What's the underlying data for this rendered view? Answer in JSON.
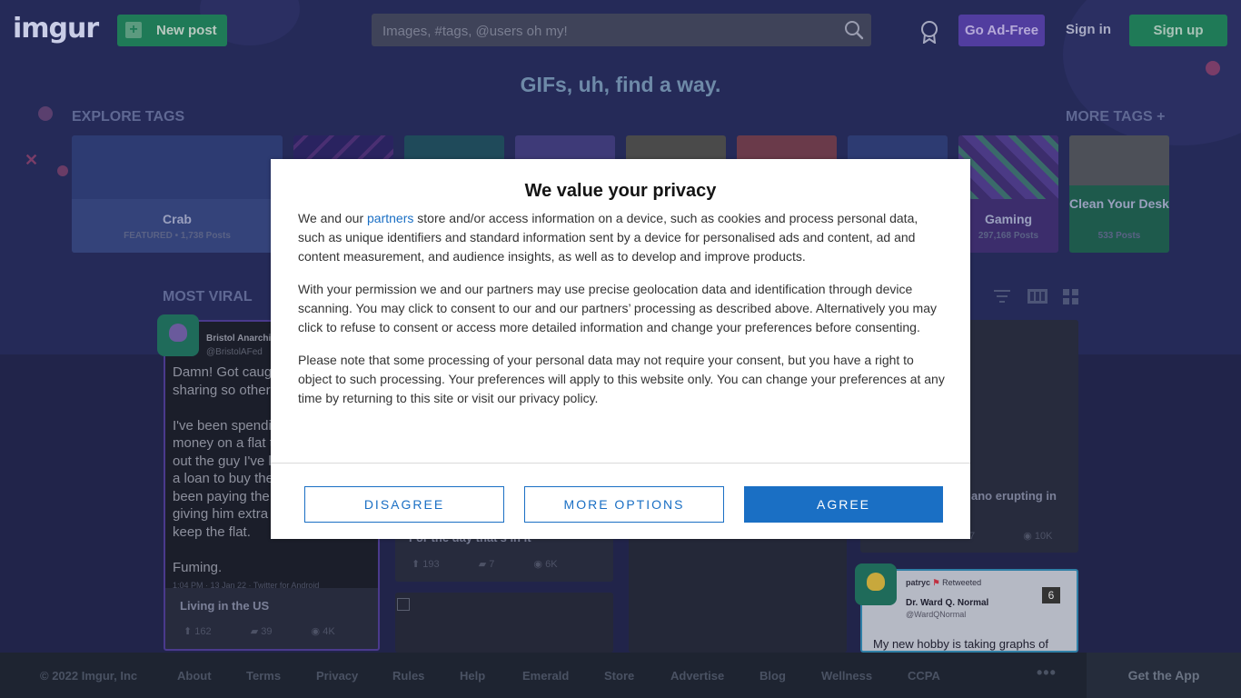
{
  "header": {
    "logo": "imgur",
    "new_post": "New post",
    "search_placeholder": "Images, #tags, @users oh my!",
    "go_ad_free": "Go Ad-Free",
    "sign_in": "Sign in",
    "sign_up": "Sign up"
  },
  "tagline": "GIFs, uh, find a way.",
  "explore": {
    "heading": "EXPLORE TAGS",
    "more": "MORE TAGS +",
    "tags": [
      {
        "name": "Crab",
        "sub": "FEATURED • 1,738 Posts"
      },
      {
        "name": "Gaming",
        "sub": "297,168 Posts"
      },
      {
        "name": "Clean Your Desk",
        "sub": "533 Posts"
      }
    ]
  },
  "feed": {
    "heading": "MOST VIRAL",
    "card1": {
      "account_name": "Bristol Anarchi",
      "account_handle": "@BristolAFed",
      "text_lines": [
        "Damn! Got caug",
        "sharing so others",
        "",
        "I've been spendi",
        "money on a flat t",
        "out the guy I've l",
        "a loan to buy the",
        "been paying the",
        "giving him extra a",
        "keep the flat.",
        "",
        "Fuming."
      ],
      "meta": "1:04 PM · 13 Jan 22 · Twitter for Android",
      "title": "Living in the US",
      "upvotes": "162",
      "comments": "39",
      "views": "4K"
    },
    "card2": {
      "title": "For the day that's in it",
      "upvotes": "193",
      "comments": "7",
      "views": "6K"
    },
    "card3": {
      "title": "ano erupting in",
      "comments": "7",
      "views": "10K"
    },
    "card4": {
      "retweet": "patryc",
      "retweet_label": "Retweeted",
      "name": "Dr. Ward Q. Normal",
      "handle": "@WardQNormal",
      "badge": "6",
      "text": "My new hobby is taking graphs of"
    }
  },
  "footer": {
    "items": [
      "© 2022 Imgur, Inc",
      "About",
      "Terms",
      "Privacy",
      "Rules",
      "Help",
      "Emerald",
      "Store",
      "Advertise",
      "Blog",
      "Wellness",
      "CCPA"
    ],
    "get_app": "Get the App"
  },
  "consent": {
    "title": "We value your privacy",
    "p1_before": "We and our ",
    "p1_link": "partners",
    "p1_after": " store and/or access information on a device, such as cookies and process personal data, such as unique identifiers and standard information sent by a device for personalised ads and content, ad and content measurement, and audience insights, as well as to develop and improve products.",
    "p2": "With your permission we and our partners may use precise geolocation data and identification through device scanning. You may click to consent to our and our partners’ processing as described above. Alternatively you may click to refuse to consent or access more detailed information and change your preferences before consenting.",
    "p3": "Please note that some processing of your personal data may not require your consent, but you have a right to object to such processing. Your preferences will apply to this website only. You can change your preferences at any time by returning to this site or visit our privacy policy.",
    "disagree": "DISAGREE",
    "more_options": "MORE OPTIONS",
    "agree": "AGREE",
    "accent_color": "#1a6fc4"
  }
}
